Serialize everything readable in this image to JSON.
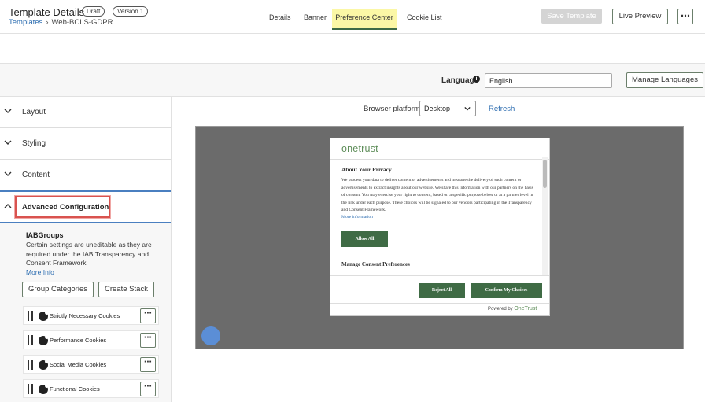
{
  "header": {
    "title": "Template Details",
    "draft_badge": "Draft",
    "version_badge": "Version 1",
    "breadcrumb_link": "Templates",
    "breadcrumb_current": "Web-BCLS-GDPR",
    "save_label": "Save Template",
    "preview_label": "Live Preview",
    "more_label": "⋯"
  },
  "tabs": [
    {
      "label": "Details"
    },
    {
      "label": "Banner"
    },
    {
      "label": "Preference Center"
    },
    {
      "label": "Cookie List"
    }
  ],
  "language": {
    "label": "Language",
    "value": "English",
    "manage_label": "Manage Languages"
  },
  "sidebar": {
    "sections": [
      {
        "label": "Layout"
      },
      {
        "label": "Styling"
      },
      {
        "label": "Content"
      },
      {
        "label": "Advanced Configuration"
      }
    ],
    "iab_title": "IABGroups",
    "iab_desc": "Certain settings are uneditable as they are required under the IAB Transparency and Consent Framework",
    "more_info": "More Info",
    "group_categories_label": "Group Categories",
    "create_stack_label": "Create Stack",
    "cookies": [
      {
        "name": "Strictly Necessary Cookies"
      },
      {
        "name": "Performance Cookies"
      },
      {
        "name": "Social Media Cookies"
      },
      {
        "name": "Functional Cookies"
      }
    ]
  },
  "preview": {
    "platform_label": "Browser platform:",
    "platform_value": "Desktop",
    "refresh_label": "Refresh",
    "modal": {
      "logo": "onetrust",
      "about_title": "About Your Privacy",
      "about_text": "We process your data to deliver content or advertisements and measure the delivery of such content or advertisements to extract insights about our website. We share this information with our partners on the basis of consent. You may exercise your right to consent, based on a specific purpose below or at a partner level in the link under each purpose. These choices will be signaled to our vendors participating in the Transparency and Consent Framework.",
      "more_information": "More information",
      "allow_all": "Allow All",
      "manage_prefs": "Manage Consent Preferences",
      "reject_all": "Reject All",
      "confirm": "Confirm My Choices",
      "powered_by": "Powered by",
      "powered_brand": "OneTrust"
    }
  },
  "colors": {
    "accent_green": "#3f6b45",
    "link_blue": "#2b6cb0",
    "active_tab": "#fbf7a6",
    "highlight_red": "#d9534f"
  }
}
